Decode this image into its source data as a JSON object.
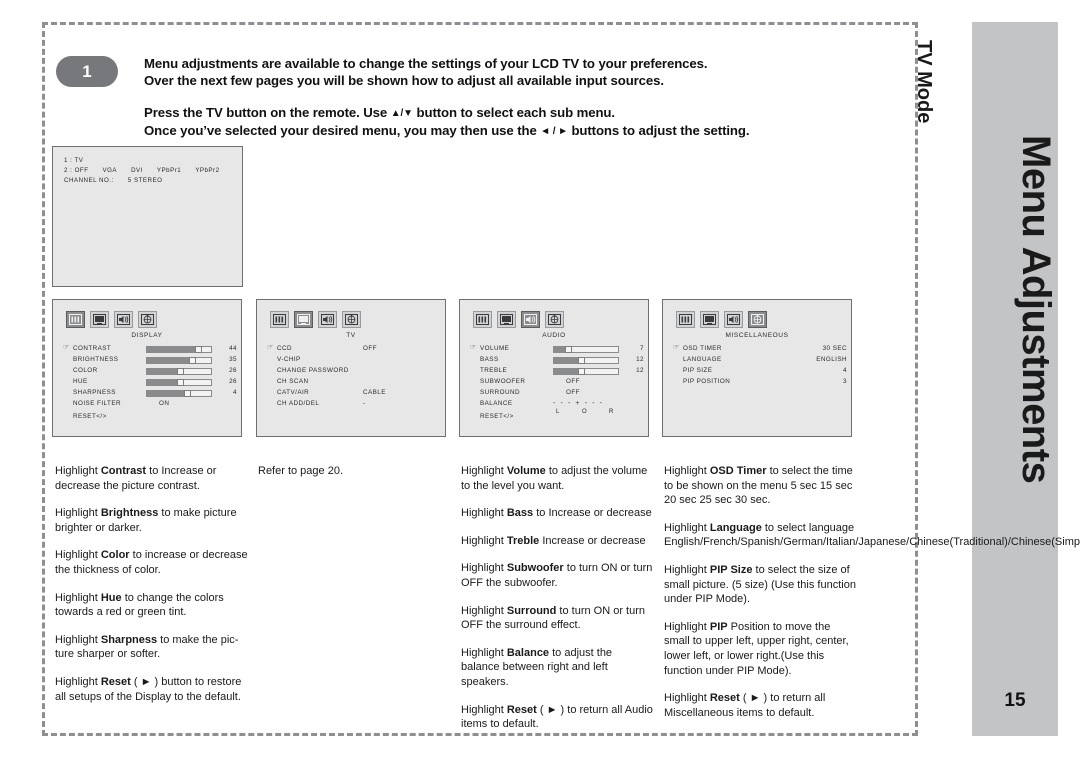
{
  "document": {
    "page_number": "15",
    "side_title": "Menu Adjustments",
    "mode_label": "TV Mode",
    "step_badge": "1"
  },
  "intro": {
    "line1": "Menu adjustments are available to change the settings of your LCD TV to your preferences.",
    "line2": "Over the next few pages you will be shown how to adjust all available input sources.",
    "line3_a": "Press the TV button on the remote.  Use ",
    "line3_arrows": "▲/▼",
    "line3_b": " button to select each sub menu.",
    "line4_a": "Once you’ve selected your desired menu, you may then use the ",
    "line4_arrows": "◄ / ►",
    "line4_b": " buttons to adjust the setting."
  },
  "tv_preview": {
    "line1": "1 : TV",
    "line2_label": "2 : OFF",
    "line2_opt1": "VGA",
    "line2_opt2": "DVI",
    "line2_opt3": "YPbPr1",
    "line2_opt4": "YPbPr2",
    "line3_label": "CHANNEL NO.:",
    "line3_value": "5 STEREO"
  },
  "osd_panels": [
    {
      "title": "DISPLAY",
      "active_tab": 0,
      "tab_names": [
        "display-icon",
        "tv-icon",
        "audio-icon",
        "miscellaneous-icon"
      ],
      "reset": "RESET</>",
      "rows": [
        {
          "label": "CONTRAST",
          "cursor": true,
          "bar": 80,
          "value": "44"
        },
        {
          "label": "BRIGHTNESS",
          "cursor": false,
          "bar": 70,
          "value": "35"
        },
        {
          "label": "COLOR",
          "cursor": false,
          "bar": 52,
          "value": "26"
        },
        {
          "label": "HUE",
          "cursor": false,
          "bar": 52,
          "value": "26"
        },
        {
          "label": "SHARPNESS",
          "cursor": false,
          "bar": 62,
          "value": "4"
        },
        {
          "label": "NOISE FILTER",
          "cursor": false,
          "center_value": "ON"
        }
      ]
    },
    {
      "title": "TV",
      "active_tab": 1,
      "tab_names": [
        "display-icon",
        "tv-icon",
        "audio-icon",
        "miscellaneous-icon"
      ],
      "reset": "",
      "rows": [
        {
          "label": "CCD",
          "cursor": true,
          "center_value": "OFF"
        },
        {
          "label": "V-CHIP",
          "cursor": false
        },
        {
          "label": "CHANGE PASSWORD",
          "cursor": false
        },
        {
          "label": "CH SCAN",
          "cursor": false
        },
        {
          "label": "CATV/AIR",
          "cursor": false,
          "center_value": "CABLE"
        },
        {
          "label": "CH ADD/DEL",
          "cursor": false,
          "center_value": "-"
        }
      ]
    },
    {
      "title": "AUDIO",
      "active_tab": 2,
      "tab_names": [
        "display-icon",
        "tv-icon",
        "audio-icon",
        "miscellaneous-icon"
      ],
      "reset": "RESET</>",
      "rows": [
        {
          "label": "VOLUME",
          "cursor": true,
          "bar": 22,
          "value": "7"
        },
        {
          "label": "BASS",
          "cursor": false,
          "bar": 42,
          "value": "12"
        },
        {
          "label": "TREBLE",
          "cursor": false,
          "bar": 42,
          "value": "12"
        },
        {
          "label": "SUBWOOFER",
          "cursor": false,
          "center_value": "OFF"
        },
        {
          "label": "SURROUND",
          "cursor": false,
          "center_value": "OFF"
        },
        {
          "label": "BALANCE",
          "cursor": false,
          "balance": "- - - + - - -",
          "balance_l": "L",
          "balance_o": "O",
          "balance_r": "R"
        }
      ]
    },
    {
      "title": "MISCELLANEOUS",
      "active_tab": 3,
      "tab_names": [
        "display-icon",
        "tv-icon",
        "audio-icon",
        "miscellaneous-icon"
      ],
      "reset": "",
      "rows": [
        {
          "label": "OSD TIMER",
          "cursor": true,
          "right_value": "30 SEC"
        },
        {
          "label": "LANGUAGE",
          "cursor": false,
          "right_value": "ENGLISH"
        },
        {
          "label": "PIP SIZE",
          "cursor": false,
          "right_value": "4"
        },
        {
          "label": "PIP POSITION",
          "cursor": false,
          "right_value": "3"
        }
      ]
    }
  ],
  "columns": [
    {
      "paragraphs": [
        {
          "pre": "Highlight ",
          "bold": "Contrast",
          "post": " to Increase or decrease the picture contrast."
        },
        {
          "pre": "Highlight ",
          "bold": "Brightness",
          "post": " to make picture brighter or darker."
        },
        {
          "pre": "Highlight ",
          "bold": "Color",
          "post": " to increase or decrease the thickness of color."
        },
        {
          "pre": "Highlight ",
          "bold": "Hue",
          "post": " to change the colors towards a red or green tint."
        },
        {
          "pre": "Highlight ",
          "bold": "Sharpness",
          "post": " to make the pic-ture sharper or softer."
        },
        {
          "pre": "Highlight ",
          "bold": "Reset",
          "post": " ( ► ) button to restore all setups of the Display to the default."
        }
      ]
    },
    {
      "paragraphs": [
        {
          "pre": "Refer to page 20.",
          "bold": "",
          "post": ""
        }
      ]
    },
    {
      "paragraphs": [
        {
          "pre": "Highlight ",
          "bold": "Volume",
          "post": " to adjust the volume to the level you want."
        },
        {
          "pre": "Highlight ",
          "bold": "Bass",
          "post": " to Increase or decrease"
        },
        {
          "pre": "Highlight ",
          "bold": "Treble",
          "post": " Increase or decrease"
        },
        {
          "pre": "Highlight ",
          "bold": "Subwoofer",
          "post": " to turn ON or turn OFF the subwoofer."
        },
        {
          "pre": "Highlight ",
          "bold": "Surround",
          "post": " to turn ON or turn OFF the surround effect."
        },
        {
          "pre": "Highlight ",
          "bold": "Balance",
          "post": " to adjust the balance between right and left speakers."
        },
        {
          "pre": "Highlight ",
          "bold": "Reset",
          "post": " ( ► ) to return all Audio items to default."
        }
      ]
    },
    {
      "paragraphs": [
        {
          "pre": "Highlight ",
          "bold": "OSD Timer",
          "post": " to select the time to be shown on the menu 5 sec 15 sec 20 sec 25 sec 30 sec."
        },
        {
          "pre": "Highlight ",
          "bold": "Language",
          "post": " to select language English/French/Spanish/German/Italian/Japanese/Chinese(Traditional)/Chinese(Simplified)."
        },
        {
          "pre": "Highlight ",
          "bold": "PIP Size",
          "post": " to select the size of small picture. (5 size) (Use this function under PIP Mode)."
        },
        {
          "pre": "Highlight ",
          "bold": "PIP",
          "post": " Position to move the small to upper left, upper right, center, lower left, or lower right.(Use this function under PIP Mode)."
        },
        {
          "pre": "Highlight ",
          "bold": "Reset",
          "post": " ( ► ) to return all Miscellaneous items to default."
        }
      ]
    }
  ]
}
